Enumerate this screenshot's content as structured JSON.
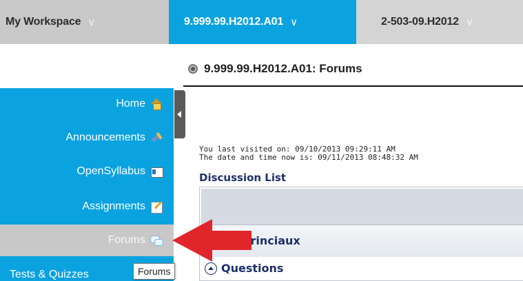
{
  "topnav": {
    "workspace": "My Workspace",
    "current_site": "9.999.99.H2012.A01",
    "other_site": "2-503-09.H2012"
  },
  "sidebar": {
    "items": [
      {
        "label": "Home",
        "icon": "home-icon"
      },
      {
        "label": "Announcements",
        "icon": "megaphone-icon"
      },
      {
        "label": "OpenSyllabus",
        "icon": "syllabus-icon"
      },
      {
        "label": "Assignments",
        "icon": "pencil-paper-icon"
      },
      {
        "label": "Forums",
        "icon": "speech-bubbles-icon",
        "active": true
      },
      {
        "label": "Tests & Quizzes",
        "icon": "quiz-icon"
      }
    ]
  },
  "tooltip": {
    "text": "Forums"
  },
  "page": {
    "title": "9.999.99.H2012.A01: Forums",
    "last_visited": "You last visited on: 09/10/2013 09:29:11 AM",
    "now": "The date and time now is: 09/11/2013 08:48:32 AM",
    "discussion_list_title": "Discussion List",
    "category_label": "princiaux",
    "questions_label": "Questions"
  },
  "colors": {
    "accent": "#0ba2e0",
    "active_item": "#c8c8c8",
    "link_text": "#1c2f6a",
    "annotation_arrow": "#e0262b"
  }
}
